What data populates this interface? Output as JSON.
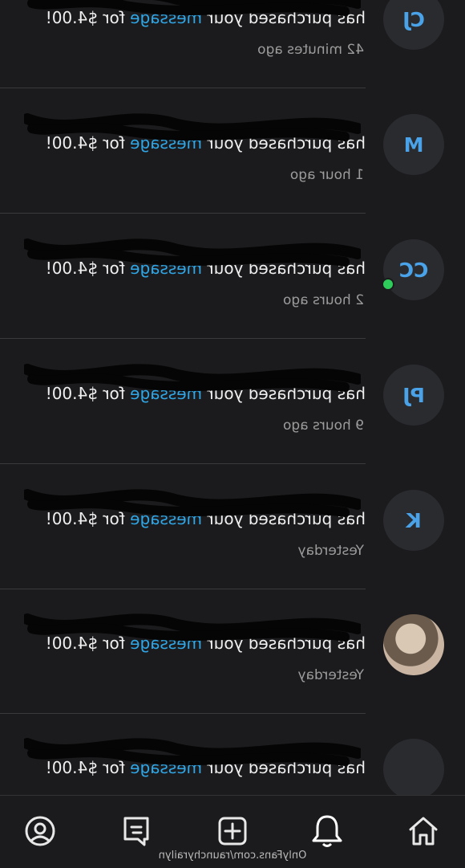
{
  "notifications": [
    {
      "avatar": "CJ",
      "sender": "",
      "text_before": "has purchased your ",
      "link": "message",
      "text_after": " for $4.00!",
      "time": "42 minutes ago",
      "online": false,
      "photo": false
    },
    {
      "avatar": "M",
      "sender": "",
      "text_before": "has purchased your ",
      "link": "message",
      "text_after": " for $4.00!",
      "time": "1 hour ago",
      "online": false,
      "photo": false
    },
    {
      "avatar": "CC",
      "sender": "",
      "text_before": "has purchased your ",
      "link": "message",
      "text_after": " for $4.00!",
      "time": "2 hours ago",
      "online": true,
      "photo": false
    },
    {
      "avatar": "PJ",
      "sender": "",
      "text_before": "has purchased your ",
      "link": "message",
      "text_after": " for $4.00!",
      "time": "9 hours ago",
      "online": false,
      "photo": false
    },
    {
      "avatar": "K",
      "sender": "",
      "text_before": "has purchased your ",
      "link": "message",
      "text_after": " for $4.00!",
      "time": "Yesterday",
      "online": false,
      "photo": false
    },
    {
      "avatar": "",
      "sender": "",
      "text_before": "has purchased your ",
      "link": "message",
      "text_after": " for $4.00!",
      "time": "Yesterday",
      "online": false,
      "photo": true
    },
    {
      "avatar": "",
      "sender": "",
      "text_before": "has purchased your ",
      "link": "message",
      "text_after": " for $4.00!",
      "time": "",
      "online": false,
      "photo": false
    }
  ],
  "tabbar": {
    "tabs": [
      "home-icon",
      "notifications-icon",
      "add-icon",
      "messages-icon",
      "profile-icon"
    ]
  },
  "watermark": "OnlyFans.com/raunchyrailyn",
  "colors": {
    "background": "#1b1b1d",
    "link": "#2fa6e6",
    "online": "#2ecc5a"
  }
}
